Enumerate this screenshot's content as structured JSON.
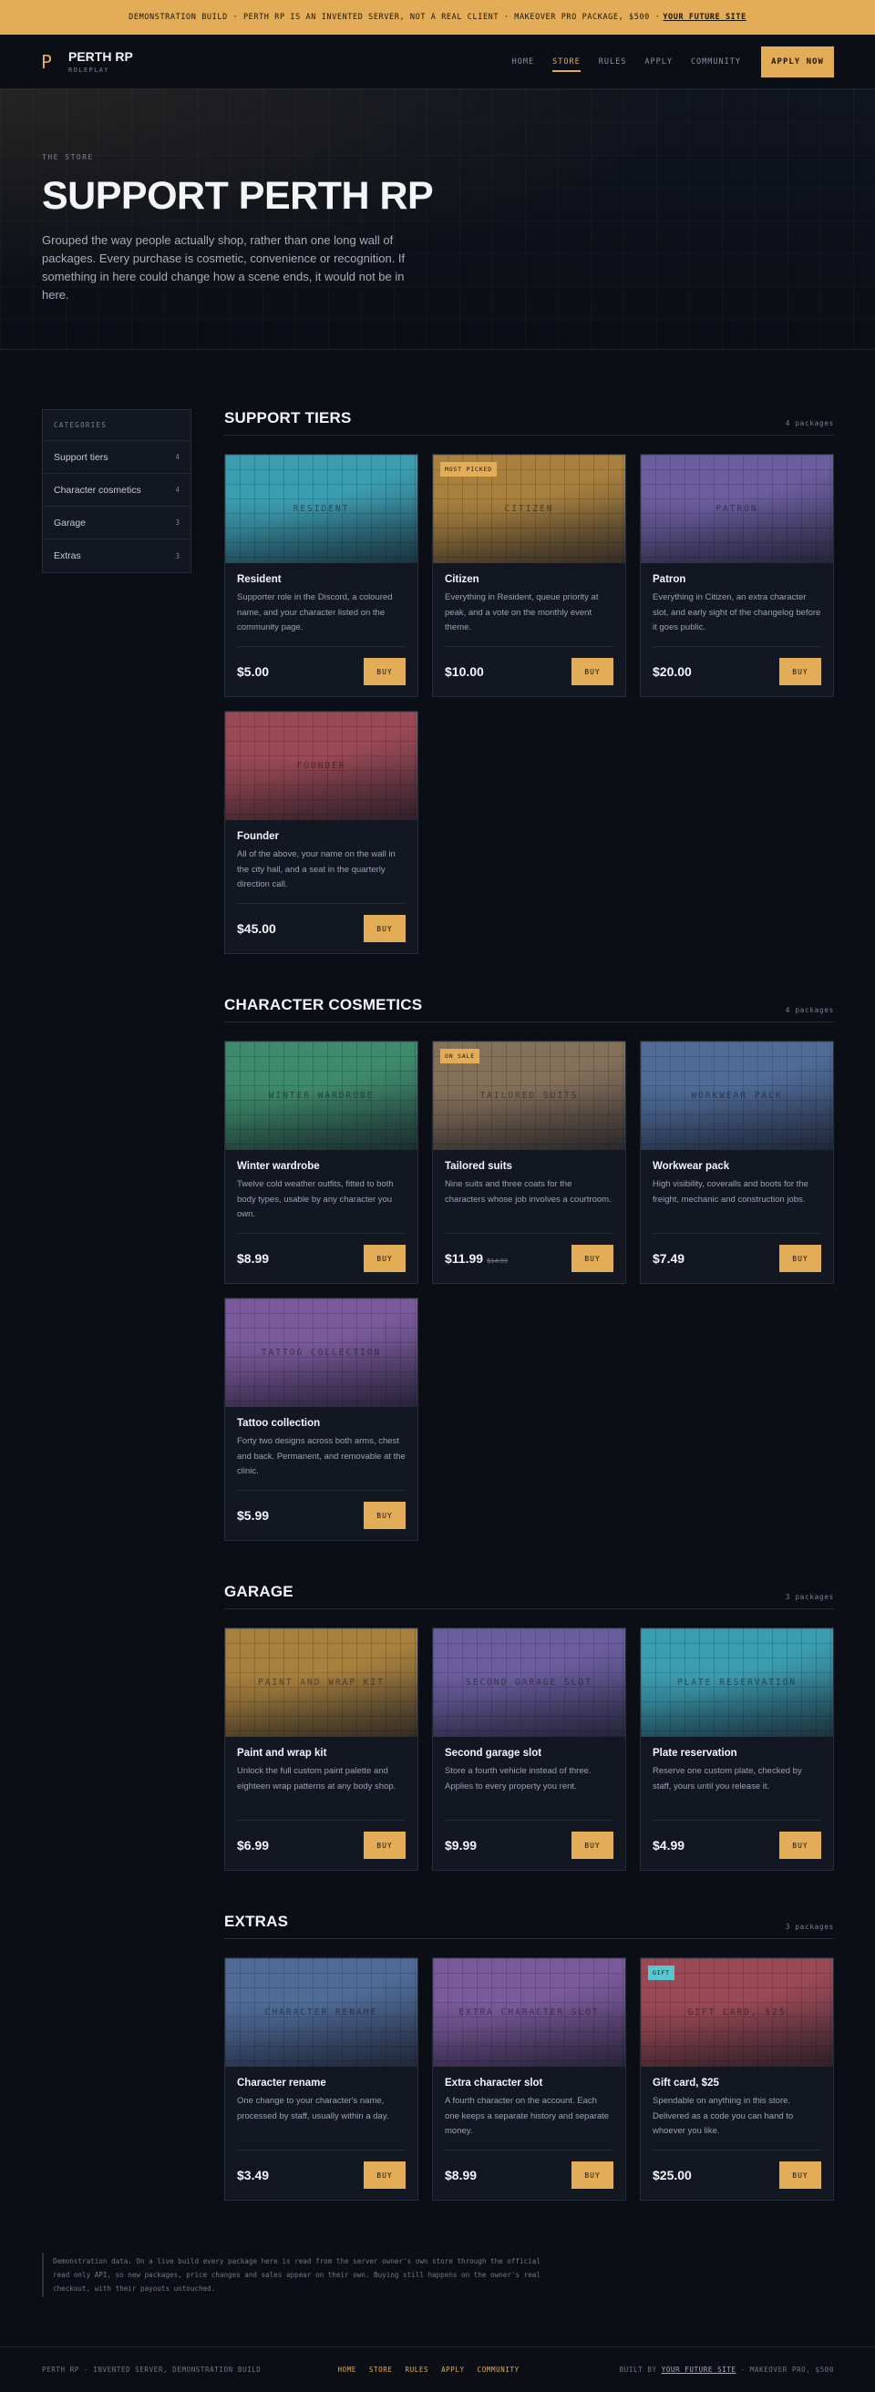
{
  "banner": {
    "text": "DEMONSTRATION BUILD · PERTH RP IS AN INVENTED SERVER, NOT A REAL CLIENT · MAKEOVER PRO PACKAGE, $500 ·",
    "link": "YOUR FUTURE SITE"
  },
  "nav": {
    "logo_mark": "P",
    "brand": "PERTH RP",
    "brand_sub": "ROLEPLAY",
    "links": [
      "HOME",
      "STORE",
      "RULES",
      "APPLY",
      "COMMUNITY"
    ],
    "active_link": "STORE",
    "cta": "APPLY NOW"
  },
  "hero": {
    "eyebrow": "THE STORE",
    "title": "SUPPORT PERTH RP",
    "text": "Grouped the way people actually shop, rather than one long wall of packages. Every purchase is cosmetic, convenience or recognition. If something in here could change how a scene ends, it would not be in here."
  },
  "sidebar": {
    "heading": "CATEGORIES",
    "items": [
      {
        "label": "Support tiers",
        "count": "4"
      },
      {
        "label": "Character cosmetics",
        "count": "4"
      },
      {
        "label": "Garage",
        "count": "3"
      },
      {
        "label": "Extras",
        "count": "3"
      }
    ]
  },
  "colors": {
    "accent": "#e3ad57",
    "background": "#0b0e15",
    "card": "#121722",
    "tag_cyan": "#55c8d3"
  },
  "sections": [
    {
      "title": "SUPPORT TIERS",
      "count": "4 packages",
      "cards": [
        {
          "thumb": "RESIDENT",
          "title": "Resident",
          "desc": "Supporter role in the Discord, a coloured name, and your character listed on the community page.",
          "price": "$5.00",
          "buy": "BUY",
          "color": "#3d9db0"
        },
        {
          "thumb": "CITIZEN",
          "tag": "MOST PICKED",
          "title": "Citizen",
          "desc": "Everything in Resident, queue priority at peak, and a vote on the monthly event theme.",
          "price": "$10.00",
          "buy": "BUY",
          "color": "#a8813f"
        },
        {
          "thumb": "PATRON",
          "title": "Patron",
          "desc": "Everything in Citizen, an extra character slot, and early sight of the changelog before it goes public.",
          "price": "$20.00",
          "buy": "BUY",
          "color": "#6b5e9e"
        },
        {
          "thumb": "FOUNDER",
          "title": "Founder",
          "desc": "All of the above, your name on the wall in the city hall, and a seat in the quarterly direction call.",
          "price": "$45.00",
          "buy": "BUY",
          "color": "#9a4a56"
        }
      ]
    },
    {
      "title": "CHARACTER COSMETICS",
      "count": "4 packages",
      "cards": [
        {
          "thumb": "WINTER WARDROBE",
          "title": "Winter wardrobe",
          "desc": "Twelve cold weather outfits, fitted to both body types, usable by any character you own.",
          "price": "$8.99",
          "buy": "BUY",
          "color": "#3f8a6c"
        },
        {
          "thumb": "TAILORED SUITS",
          "tag": "ON SALE",
          "title": "Tailored suits",
          "desc": "Nine suits and three coats for the characters whose job involves a courtroom.",
          "price": "$11.99",
          "old_price": "$14.99",
          "buy": "BUY",
          "color": "#85705a"
        },
        {
          "thumb": "WORKWEAR PACK",
          "title": "Workwear pack",
          "desc": "High visibility, coveralls and boots for the freight, mechanic and construction jobs.",
          "price": "$7.49",
          "buy": "BUY",
          "color": "#4f6b96"
        },
        {
          "thumb": "TATTOO COLLECTION",
          "title": "Tattoo collection",
          "desc": "Forty two designs across both arms, chest and back. Permanent, and removable at the clinic.",
          "price": "$5.99",
          "buy": "BUY",
          "color": "#7a5a9a"
        }
      ]
    },
    {
      "title": "GARAGE",
      "count": "3 packages",
      "cards": [
        {
          "thumb": "PAINT AND WRAP KIT",
          "title": "Paint and wrap kit",
          "desc": "Unlock the full custom paint palette and eighteen wrap patterns at any body shop.",
          "price": "$6.99",
          "buy": "BUY",
          "color": "#a8813f"
        },
        {
          "thumb": "SECOND GARAGE SLOT",
          "title": "Second garage slot",
          "desc": "Store a fourth vehicle instead of three. Applies to every property you rent.",
          "price": "$9.99",
          "buy": "BUY",
          "color": "#6b5e9e"
        },
        {
          "thumb": "PLATE RESERVATION",
          "title": "Plate reservation",
          "desc": "Reserve one custom plate, checked by staff, yours until you release it.",
          "price": "$4.99",
          "buy": "BUY",
          "color": "#3d9db0"
        }
      ]
    },
    {
      "title": "EXTRAS",
      "count": "3 packages",
      "cards": [
        {
          "thumb": "CHARACTER RENAME",
          "title": "Character rename",
          "desc": "One change to your character's name, processed by staff, usually within a day.",
          "price": "$3.49",
          "buy": "BUY",
          "color": "#4f6b96"
        },
        {
          "thumb": "EXTRA CHARACTER SLOT",
          "title": "Extra character slot",
          "desc": "A fourth character on the account. Each one keeps a separate history and separate money.",
          "price": "$8.99",
          "buy": "BUY",
          "color": "#7a5a9a"
        },
        {
          "thumb": "GIFT CARD, $25",
          "tag": "GIFT",
          "tag_style": "cyan",
          "title": "Gift card, $25",
          "desc": "Spendable on anything in this store. Delivered as a code you can hand to whoever you like.",
          "price": "$25.00",
          "buy": "BUY",
          "color": "#9a4a56"
        }
      ]
    }
  ],
  "note": "Demonstration data. On a live build every package here is read from the server owner's own store through the official read only API, so new packages, price changes and sales appear on their own. Buying still happens on the owner's real checkout, with their payouts untouched.",
  "footer": {
    "left": "PERTH RP · INVENTED SERVER, DEMONSTRATION BUILD",
    "links": [
      "HOME",
      "STORE",
      "RULES",
      "APPLY",
      "COMMUNITY"
    ],
    "right_prefix": "BUILT BY",
    "right_link": "YOUR FUTURE SITE",
    "right_suffix": "· MAKEOVER PRO, $500"
  }
}
